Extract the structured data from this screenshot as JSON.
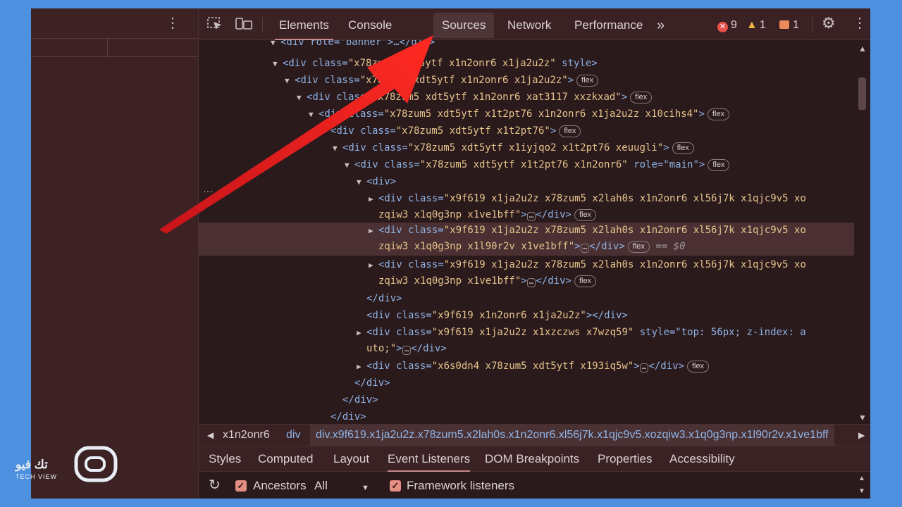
{
  "toolbar": {
    "tabs": [
      "Elements",
      "Console",
      "Sources",
      "Network",
      "Performance"
    ],
    "more_tabs": "»",
    "errors": "9",
    "warnings": "1",
    "issues": "1"
  },
  "dom_lines": [
    {
      "tw": "▼",
      "html": "<div role=\"banner\">…</div>"
    },
    {
      "tw": "▼",
      "tag": "<div class=",
      "val": "\"x78zum5 xdt5ytf x1n2onr6 x1ja2u2z\"",
      "rest": " style>"
    },
    {
      "tw": "▼",
      "tag": "<div class=",
      "val": "\"x78zum5 xdt5ytf x1n2onr6 x1ja2u2z\"",
      "rest": ">",
      "flex": "flex"
    },
    {
      "tw": "▼",
      "tag": "<div class=",
      "val": "\"x78zum5 xdt5ytf x1n2onr6 xat3117 xxzkxad\"",
      "rest": ">",
      "flex": "flex"
    },
    {
      "tw": "▼",
      "tag": "<div class=",
      "val": "\"x78zum5 xdt5ytf x1t2pt76 x1n2onr6 x1ja2u2z x10cihs4\"",
      "rest": ">",
      "flex": "flex"
    },
    {
      "tw": "▼",
      "tag": "<div class=",
      "val": "\"x78zum5 xdt5ytf x1t2pt76\"",
      "rest": ">",
      "flex": "flex"
    },
    {
      "tw": "▼",
      "tag": "<div class=",
      "val": "\"x78zum5 xdt5ytf x1iyjqo2 x1t2pt76 xeuugli\"",
      "rest": ">",
      "flex": "flex"
    },
    {
      "tw": "▼",
      "tag": "<div class=",
      "val": "\"x78zum5 xdt5ytf x1t2pt76 x1n2onr6\"",
      "rest": " role=\"main\">",
      "flex": "flex"
    },
    {
      "tw": "▼",
      "tag": "<div>"
    },
    {
      "tw": "▶",
      "tag": "<div class=",
      "val": "\"x9f619 x1ja2u2z x78zum5 x2lah0s x1n2onr6 xl56j7k x1qjc9v5 xo",
      "line2": "zqiw3 x1q0g3np x1ve1bff\"",
      "rest2": ">",
      "dots": "…",
      "close": "</div>",
      "flex": "flex"
    },
    {
      "tw": "▶",
      "tag": "<div class=",
      "val": "\"x9f619 x1ja2u2z x78zum5 x2lah0s x1n2onr6 xl56j7k x1qjc9v5 xo",
      "line2": "zqiw3 x1q0g3np x1l90r2v x1ve1bff\"",
      "rest2": ">",
      "dots": "…",
      "close": "</div>",
      "flex": "flex",
      "sel": "== $0"
    },
    {
      "tw": "▶",
      "tag": "<div class=",
      "val": "\"x9f619 x1ja2u2z x78zum5 x2lah0s x1n2onr6 xl56j7k x1qjc9v5 xo",
      "line2": "zqiw3 x1q0g3np x1ve1bff\"",
      "rest2": ">",
      "dots": "…",
      "close": "</div>",
      "flex": "flex"
    },
    {
      "tw": "",
      "tag": "</div>"
    },
    {
      "tw": "",
      "tag": "<div class=",
      "val": "\"x9f619 x1n2onr6 x1ja2u2z\"",
      "rest": "></div>"
    },
    {
      "tw": "▶",
      "tag": "<div class=",
      "val": "\"x9f619 x1ja2u2z x1xzczws x7wzq59\"",
      "rest": " style=\"top: 56px; z-index: a",
      "line2": "uto;\"",
      "rest2": ">",
      "dots": "…",
      "close": "</div>"
    },
    {
      "tw": "▶",
      "tag": "<div class=",
      "val": "\"x6s0dn4 x78zum5 xdt5ytf x193iq5w\"",
      "rest": ">",
      "dots": "…",
      "close": "</div>",
      "flex": "flex"
    },
    {
      "tw": "",
      "tag": "</div>"
    },
    {
      "tw": "",
      "tag": "</div>"
    },
    {
      "tw": "",
      "tag": "</div>"
    }
  ],
  "breadcrumbs": {
    "items": [
      "x1n2onr6",
      "div"
    ],
    "active": "div.x9f619.x1ja2u2z.x78zum5.x2lah0s.x1n2onr6.xl56j7k.x1qjc9v5.xozqiw3.x1q0g3np.x1l90r2v.x1ve1bff"
  },
  "lower_tabs": [
    "Styles",
    "Computed",
    "Layout",
    "Event Listeners",
    "DOM Breakpoints",
    "Properties",
    "Accessibility"
  ],
  "filters": {
    "ancestors_label": "Ancestors",
    "ancestors_checked": true,
    "select_value": "All",
    "framework_label": "Framework listeners",
    "framework_checked": true
  },
  "watermark": {
    "text": "تك فيو",
    "sub": "TECH VIEW"
  },
  "colors": {
    "accent_arrow": "#e8231e",
    "panel_bg": "#2a1a1c",
    "outer_bg": "#4e90e0"
  }
}
